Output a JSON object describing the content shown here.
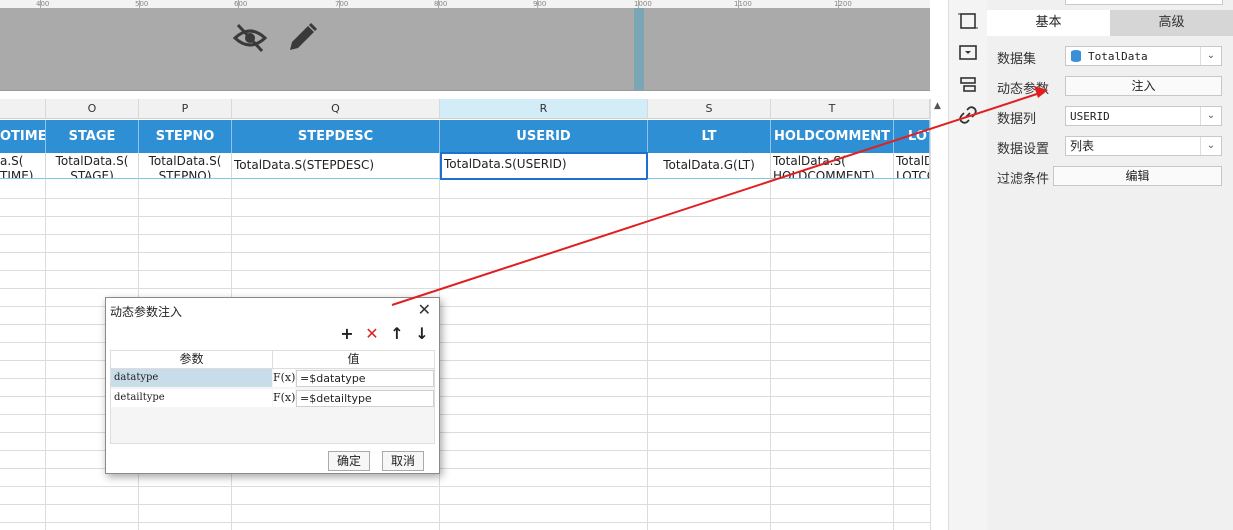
{
  "ruler_ticks": [
    "400",
    "500",
    "600",
    "700",
    "800",
    "900",
    "1000",
    "1100",
    "1200"
  ],
  "columns": [
    {
      "letter": "",
      "header": "OTIME",
      "cell": "a.S(\nTIME)"
    },
    {
      "letter": "O",
      "header": "STAGE",
      "cell": "TotalData.S(\nSTAGE)"
    },
    {
      "letter": "P",
      "header": "STEPNO",
      "cell": "TotalData.S(\nSTEPNO)"
    },
    {
      "letter": "Q",
      "header": "STEPDESC",
      "cell": "TotalData.S(STEPDESC)"
    },
    {
      "letter": "R",
      "header": "USERID",
      "cell": "TotalData.S(USERID)"
    },
    {
      "letter": "S",
      "header": "LT",
      "cell": "TotalData.G(LT)"
    },
    {
      "letter": "T",
      "header": "HOLDCOMMENT",
      "cell": "TotalData.S(\nHOLDCOMMENT)"
    },
    {
      "letter": "",
      "header": "LOT",
      "cell": "TotalD\nLOTCO"
    }
  ],
  "panel": {
    "tab_basic": "基本",
    "tab_advanced": "高级",
    "dataset_label": "数据集",
    "dataset_value": "TotalData",
    "dyn_param_label": "动态参数",
    "dyn_param_button": "注入",
    "data_column_label": "数据列",
    "data_column_value": "USERID",
    "data_setting_label": "数据设置",
    "data_setting_value": "列表",
    "filter_label": "过滤条件",
    "filter_button": "编辑"
  },
  "dialog": {
    "title": "动态参数注入",
    "col_param": "参数",
    "col_value": "值",
    "rows": [
      {
        "param": "datatype",
        "fx": "F(x)",
        "value": "=$datatype"
      },
      {
        "param": "detailtype",
        "fx": "F(x)",
        "value": "=$detailtype"
      }
    ],
    "ok": "确定",
    "cancel": "取消"
  },
  "colors": {
    "header_blue": "#2e8fd4",
    "arrow_red": "#e02020",
    "selected_row": "#c9dcea"
  }
}
